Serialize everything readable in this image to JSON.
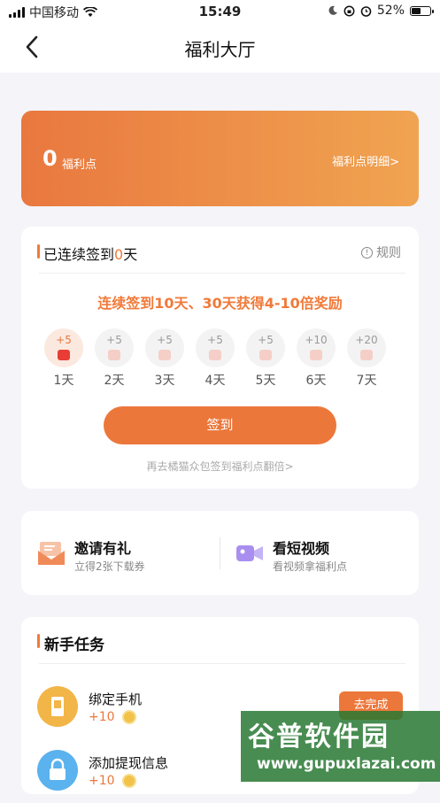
{
  "status_bar": {
    "carrier": "中国移动",
    "time": "15:49",
    "battery": "52%",
    "battery_level": 0.52
  },
  "nav": {
    "title": "福利大厅"
  },
  "points_card": {
    "value": "0",
    "unit": "福利点",
    "detail_link": "福利点明细>"
  },
  "sign_in": {
    "streak_prefix": "已连续签到",
    "streak_days": "0",
    "streak_suffix": "天",
    "rules_label": "规则",
    "promo": "连续签到10天、30天获得4-10倍奖励",
    "days": [
      {
        "amount": "+5",
        "label": "1天"
      },
      {
        "amount": "+5",
        "label": "2天"
      },
      {
        "amount": "+5",
        "label": "3天"
      },
      {
        "amount": "+5",
        "label": "4天"
      },
      {
        "amount": "+5",
        "label": "5天"
      },
      {
        "amount": "+10",
        "label": "6天"
      },
      {
        "amount": "+20",
        "label": "7天"
      }
    ],
    "button": "签到",
    "link": "再去橘猫众包签到福利点翻倍>"
  },
  "activities": [
    {
      "title": "邀请有礼",
      "subtitle": "立得2张下载券",
      "icon": "gift-envelope-icon"
    },
    {
      "title": "看短视频",
      "subtitle": "看视频拿福利点",
      "icon": "video-camera-icon"
    }
  ],
  "tasks": {
    "title": "新手任务",
    "items": [
      {
        "name": "绑定手机",
        "reward": "+10",
        "action": "去完成",
        "icon": "phone-icon"
      },
      {
        "name": "添加提现信息",
        "reward": "+10",
        "action": "",
        "icon": "lock-icon"
      }
    ]
  },
  "watermark": {
    "line1": "谷普软件园",
    "line2": "www.gupuxlazai.com"
  },
  "colors": {
    "accent": "#ec773b",
    "gradient_start": "#e9783f",
    "gradient_end": "#f0a451",
    "background": "#f4f4f9"
  }
}
